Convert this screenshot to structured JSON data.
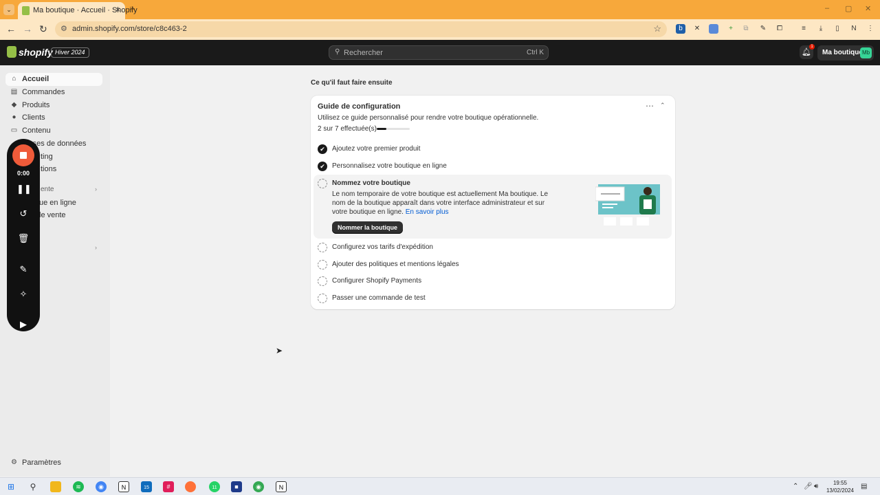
{
  "browser": {
    "tab_title": "Ma boutique · Accueil · Shopify",
    "tab_close": "×",
    "new_tab": "+",
    "url": "admin.shopify.com/store/c8c463-2",
    "window_controls": [
      "–",
      "▢",
      "✕"
    ]
  },
  "shopify_bar": {
    "logo": "shopify",
    "edition": "Hiver 2024",
    "search_placeholder": "Rechercher",
    "search_shortcut": "Ctrl K",
    "notification_count": "1",
    "store_name": "Ma boutique",
    "store_initials": "Mb"
  },
  "sidebar": {
    "items": [
      {
        "label": "Accueil",
        "icon": "home-icon",
        "active": true
      },
      {
        "label": "Commandes",
        "icon": "inbox-icon"
      },
      {
        "label": "Produits",
        "icon": "tag-icon"
      },
      {
        "label": "Clients",
        "icon": "person-icon"
      },
      {
        "label": "Contenu",
        "icon": "monitor-icon"
      },
      {
        "label": "rses de données",
        "icon": "chart-icon"
      },
      {
        "label": "ting",
        "icon": "target-icon"
      },
      {
        "label": "tions",
        "icon": "percent-icon"
      }
    ],
    "section_label": "ente",
    "sales_channels": [
      "ue en ligne",
      "le vente"
    ],
    "settings_label": "Paramètres"
  },
  "recorder": {
    "time": "0:00"
  },
  "main": {
    "heading": "Ce qu'il faut faire ensuite",
    "guide": {
      "title": "Guide de configuration",
      "description": "Utilisez ce guide personnalisé pour rendre votre boutique opérationnelle.",
      "progress_text": "2 sur 7 effectuée(s)",
      "progress_fraction": 0.2857,
      "done_tasks": [
        "Ajoutez votre premier produit",
        "Personnalisez votre boutique en ligne"
      ],
      "expanded_task": {
        "title": "Nommez votre boutique",
        "body": "Le nom temporaire de votre boutique est actuellement Ma boutique. Le nom de la boutique apparaît dans votre interface administrateur et sur votre boutique en ligne.",
        "link": "En savoir plus",
        "button": "Nommer la boutique"
      },
      "pending_tasks": [
        "Configurez vos tarifs d'expédition",
        "Ajouter des politiques et mentions légales",
        "Configurer Shopify Payments",
        "Passer une commande de test"
      ]
    }
  },
  "taskbar": {
    "time": "19:55",
    "date": "13/02/2024",
    "badges": {
      "outlook": "15",
      "whatsapp": "11"
    }
  },
  "colors": {
    "browser_accent": "#f7a83b",
    "shopify_green": "#95bf47",
    "link_blue": "#005bd3",
    "record_red": "#ef5b3a"
  }
}
